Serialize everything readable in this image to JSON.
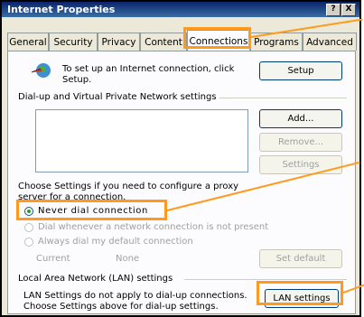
{
  "window": {
    "title": "Internet Properties",
    "help_btn": "?",
    "close_btn": "X"
  },
  "tabs": [
    {
      "label": "General"
    },
    {
      "label": "Security"
    },
    {
      "label": "Privacy"
    },
    {
      "label": "Content"
    },
    {
      "label": "Connections"
    },
    {
      "label": "Programs"
    },
    {
      "label": "Advanced"
    }
  ],
  "setup": {
    "text_line1": "To set up an Internet connection, click",
    "text_line2": "Setup.",
    "button": "Setup"
  },
  "dialup": {
    "group_label": "Dial-up and Virtual Private Network settings",
    "add": "Add...",
    "remove": "Remove...",
    "settings": "Settings"
  },
  "proxy": {
    "line1": "Choose Settings if you need to configure a proxy",
    "line2": "server for a connection."
  },
  "radios": {
    "never": "Never dial connection",
    "whenever": "Dial whenever a network connection is not present",
    "always": "Always dial my default connection"
  },
  "current": {
    "label": "Current",
    "value": "None",
    "set_default": "Set default"
  },
  "lan": {
    "group_label": "Local Area Network (LAN) settings",
    "line1": "LAN Settings do not apply to dial-up connections.",
    "line2": "Choose Settings above for dial-up settings.",
    "button": "LAN settings"
  },
  "highlight_color": "#ff9a1f"
}
